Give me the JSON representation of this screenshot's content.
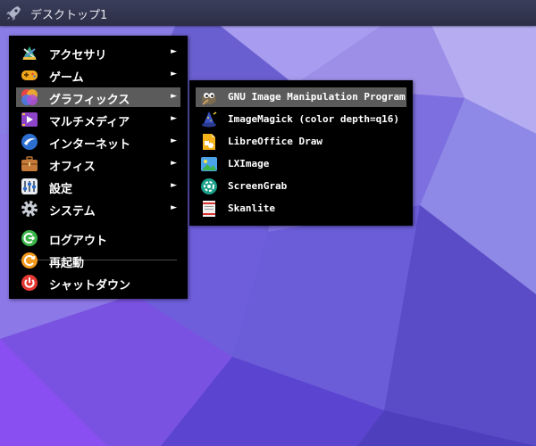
{
  "panel": {
    "desktop_label": "デスクトップ1",
    "launcher_icon": "rocket-icon"
  },
  "main_menu": {
    "items": [
      {
        "label": "アクセサリ",
        "icon": "accessories-icon",
        "has_submenu": true
      },
      {
        "label": "ゲーム",
        "icon": "gamepad-icon",
        "has_submenu": true
      },
      {
        "label": "グラフィックス",
        "icon": "graphics-icon",
        "has_submenu": true,
        "active": true
      },
      {
        "label": "マルチメディア",
        "icon": "multimedia-icon",
        "has_submenu": true
      },
      {
        "label": "インターネット",
        "icon": "internet-icon",
        "has_submenu": true
      },
      {
        "label": "オフィス",
        "icon": "briefcase-icon",
        "has_submenu": true
      },
      {
        "label": "設定",
        "icon": "settings-icon",
        "has_submenu": true
      },
      {
        "label": "システム",
        "icon": "system-gear-icon",
        "has_submenu": true
      }
    ],
    "actions": [
      {
        "label": "ログアウト",
        "icon": "logout-icon"
      },
      {
        "label": "再起動",
        "icon": "reboot-icon"
      },
      {
        "label": "シャットダウン",
        "icon": "power-icon"
      }
    ],
    "submenu_arrow": "►"
  },
  "graphics_submenu": {
    "items": [
      {
        "label": "GNU Image Manipulation Program",
        "icon": "gimp-icon",
        "active": true
      },
      {
        "label": "ImageMagick (color depth=q16)",
        "icon": "imagemagick-wizard-icon"
      },
      {
        "label": "LibreOffice Draw",
        "icon": "libreoffice-draw-icon"
      },
      {
        "label": "LXImage",
        "icon": "lximage-icon"
      },
      {
        "label": "ScreenGrab",
        "icon": "screengrab-icon"
      },
      {
        "label": "Skanlite",
        "icon": "skanlite-icon"
      }
    ]
  },
  "colors": {
    "menu_bg": "#000000",
    "highlight": "#5b5b5b",
    "panel_bg": "#2b2e46",
    "wallpaper_base": "#6a5fd0"
  }
}
